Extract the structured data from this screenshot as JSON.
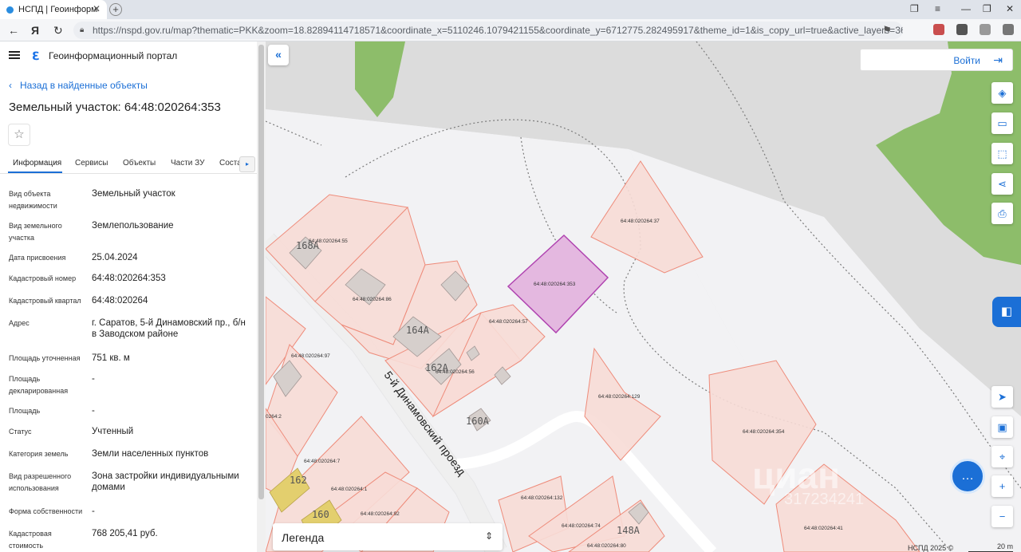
{
  "browser": {
    "tab_title": "НСПД | Геоинформаци",
    "url": "https://nspd.gov.ru/map?thematic=PKK&zoom=18.82894114718571&coordinate_x=5110246.1079421155&coordinate_y=6712775.282495917&theme_id=1&is_copy_url=true&active_layers=36048"
  },
  "header": {
    "portal_title": "Геоинформационный портал"
  },
  "panel": {
    "back_link": "Назад в найденные объекты",
    "title": "Земельный участок: 64:48:020264:353",
    "tabs": [
      "Информация",
      "Сервисы",
      "Объекты",
      "Части ЗУ",
      "Соста"
    ],
    "rows": [
      {
        "label": "Вид объекта недвижимости",
        "value": "Земельный участок"
      },
      {
        "label": "Вид земельного участка",
        "value": "Землепользование"
      },
      {
        "label": "Дата присвоения",
        "value": "25.04.2024"
      },
      {
        "label": "Кадастровый номер",
        "value": "64:48:020264:353"
      },
      {
        "label": "Кадастровый квартал",
        "value": "64:48:020264"
      },
      {
        "label": "Адрес",
        "value": "г. Саратов, 5-й Динамовский пр., б/н в Заводском районе"
      },
      {
        "label": "Площадь уточненная",
        "value": "751 кв. м"
      },
      {
        "label": "Площадь декларированная",
        "value": "-"
      },
      {
        "label": "Площадь",
        "value": "-"
      },
      {
        "label": "Статус",
        "value": "Учтенный"
      },
      {
        "label": "Категория земель",
        "value": "Земли населенных пунктов"
      },
      {
        "label": "Вид разрешенного использования",
        "value": "Зона застройки индивидуальными домами"
      },
      {
        "label": "Форма собственности",
        "value": "-"
      },
      {
        "label": "Кадастровая стоимость",
        "value": "768 205,41 руб."
      }
    ]
  },
  "map": {
    "login_label": "Войти",
    "legend_label": "Легенда",
    "attribution": "НСПД 2025 ©",
    "scale_label": "20 m",
    "street_label": "5-й Динамовский проезд",
    "watermark": "циан",
    "watermark_sub": "317234241",
    "parcel_labels": [
      "64:48:020264:55",
      "64:48:020264:86",
      "64:48:020264:353",
      "64:48:020264:57",
      "64:48:020264:37",
      "64:48:020264:97",
      "64:48:020264:56",
      "64:48:020264:129",
      "64:48:020264:354",
      "0264:2",
      "64:48:020264:7",
      "64:48:020264:1",
      "64:48:020264:92",
      "64:48:020264:132",
      "64:48:020264:74",
      "64:48:020264:80",
      "64:48:020264:41"
    ],
    "house_numbers": [
      "168А",
      "164А",
      "162А",
      "160А",
      "162",
      "160",
      "148А"
    ],
    "colors": {
      "parcel_fill": "#f7dcd6",
      "parcel_stroke": "#ee8b7a",
      "selected_fill": "#e4b8e0",
      "selected_stroke": "#b044b0",
      "green": "#8dbd6a",
      "accent": "#1b6fd6"
    }
  }
}
